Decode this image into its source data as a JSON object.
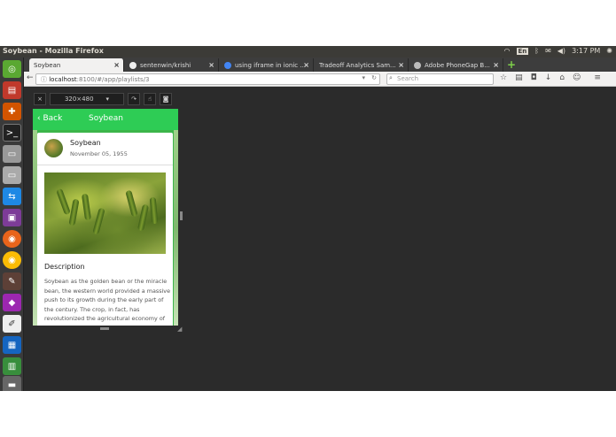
{
  "window": {
    "title": "Soybean - Mozilla Firefox"
  },
  "system": {
    "keyboard": "En",
    "time": "3:17 PM"
  },
  "tabs": [
    {
      "label": "Soybean",
      "active": true
    },
    {
      "label": "sentenwin/krishi",
      "active": false
    },
    {
      "label": "using iframe in ionic ...",
      "active": false
    },
    {
      "label": "Tradeoff Analytics Sam...",
      "active": false
    },
    {
      "label": "Adobe PhoneGap B...",
      "active": false
    }
  ],
  "nav": {
    "url_host": "localhost",
    "url_rest": ":8100/#/app/playlists/3",
    "search_placeholder": "Search"
  },
  "responsive": {
    "size_label": "320×480"
  },
  "app": {
    "back_label": "Back",
    "title": "Soybean",
    "item": {
      "name": "Soybean",
      "date": "November 05, 1955"
    },
    "description_title": "Description",
    "description": "Soybean as the golden bean or the miracle bean, the western world provided a massive push to its growth during the early part of the century. The crop, in fact, has revolutionized the agricultural economy of the USA"
  },
  "colors": {
    "accent": "#2ecc55",
    "dark_bg": "#2b2b2b"
  }
}
